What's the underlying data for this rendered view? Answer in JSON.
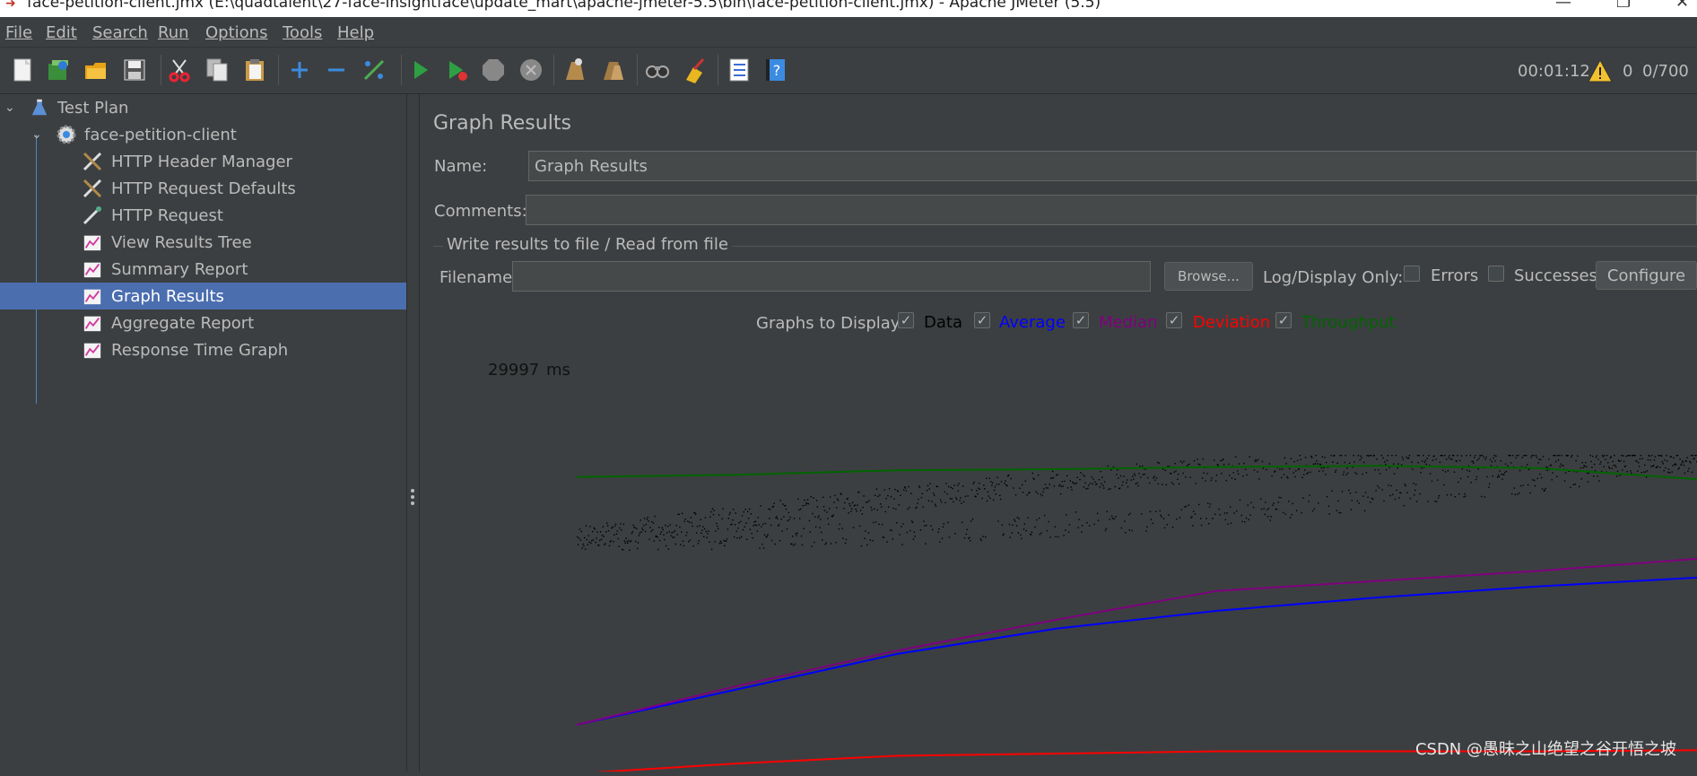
{
  "window": {
    "title": "face-petition-client.jmx (E:\\quadtalent\\27-face-insightface\\update_mart\\apache-jmeter-5.5\\bin\\face-petition-client.jmx) - Apache JMeter (5.5)"
  },
  "menu": {
    "file": "File",
    "edit": "Edit",
    "search": "Search",
    "run": "Run",
    "options": "Options",
    "tools": "Tools",
    "help": "Help"
  },
  "toolbar": {
    "icons": [
      "new-icon",
      "templates-icon",
      "open-icon",
      "save-icon",
      "cut-icon",
      "copy-icon",
      "paste-icon",
      "expand-icon",
      "collapse-icon",
      "toggle-icon",
      "start-icon",
      "start-no-pauses-icon",
      "stop-icon",
      "shutdown-icon",
      "clear-icon",
      "clear-all-icon",
      "search-icon",
      "reset-search-icon",
      "function-helper-icon",
      "help-icon"
    ],
    "elapsed_time": "00:01:12",
    "warning_count": "0",
    "active_threads": "0/700"
  },
  "tree": {
    "items": [
      {
        "label": "Test Plan",
        "icon": "flask-icon"
      },
      {
        "label": "face-petition-client",
        "icon": "gear-icon"
      },
      {
        "label": "HTTP Header Manager",
        "icon": "wrench-icon"
      },
      {
        "label": "HTTP Request Defaults",
        "icon": "wrench-icon"
      },
      {
        "label": "HTTP Request",
        "icon": "pipette-icon"
      },
      {
        "label": "View Results Tree",
        "icon": "listener-graph-icon"
      },
      {
        "label": "Summary Report",
        "icon": "listener-graph-icon"
      },
      {
        "label": "Graph Results",
        "icon": "listener-graph-icon",
        "selected": true
      },
      {
        "label": "Aggregate Report",
        "icon": "listener-graph-icon"
      },
      {
        "label": "Response Time Graph",
        "icon": "listener-graph-icon"
      }
    ]
  },
  "panel": {
    "title": "Graph Results",
    "name_label": "Name:",
    "name_value": "Graph Results",
    "comments_label": "Comments:",
    "comments_value": "",
    "file_group_title": "Write results to file / Read from file",
    "filename_label": "Filename",
    "filename_value": "",
    "browse_button": "Browse...",
    "log_display_label": "Log/Display Only:",
    "errors_label": "Errors",
    "successes_label": "Successes",
    "configure_button": "Configure",
    "graphs_to_display_label": "Graphs to Display",
    "graph_toggles": [
      {
        "label": "Data",
        "checked": true,
        "color": "#000000"
      },
      {
        "label": "Average",
        "checked": true,
        "color": "#0000ff"
      },
      {
        "label": "Median",
        "checked": true,
        "color": "#800080"
      },
      {
        "label": "Deviation",
        "checked": true,
        "color": "#ff0000"
      },
      {
        "label": "Throughput",
        "checked": true,
        "color": "#006400"
      }
    ],
    "y_max_value": "29997",
    "y_unit": "ms"
  },
  "colors": {
    "background": "#3c3f41",
    "selection": "#4b6eaf",
    "data": "#000000",
    "average": "#0000ff",
    "median": "#800080",
    "deviation": "#ff0000",
    "throughput": "#006400"
  },
  "chart_data": {
    "type": "line",
    "ylim": [
      0,
      29997
    ],
    "y_unit": "ms",
    "grid": false,
    "series": [
      {
        "name": "Average",
        "color": "#0000ff",
        "values": [
          5600,
          8800,
          12000,
          14300,
          15900,
          17100,
          18100,
          18900
        ]
      },
      {
        "name": "Median",
        "color": "#800080",
        "values": [
          5600,
          9100,
          12300,
          15100,
          17700,
          18600,
          19500,
          20600
        ]
      },
      {
        "name": "Deviation",
        "color": "#ff0000",
        "values": [
          1200,
          2100,
          2800,
          3000,
          3200,
          3200,
          3200,
          3300
        ]
      },
      {
        "name": "Throughput",
        "color": "#006400",
        "values": [
          28000,
          28200,
          28600,
          28700,
          28900,
          29000,
          28800,
          27800
        ]
      }
    ]
  },
  "watermark": "CSDN @愚昧之山绝望之谷开悟之坡"
}
